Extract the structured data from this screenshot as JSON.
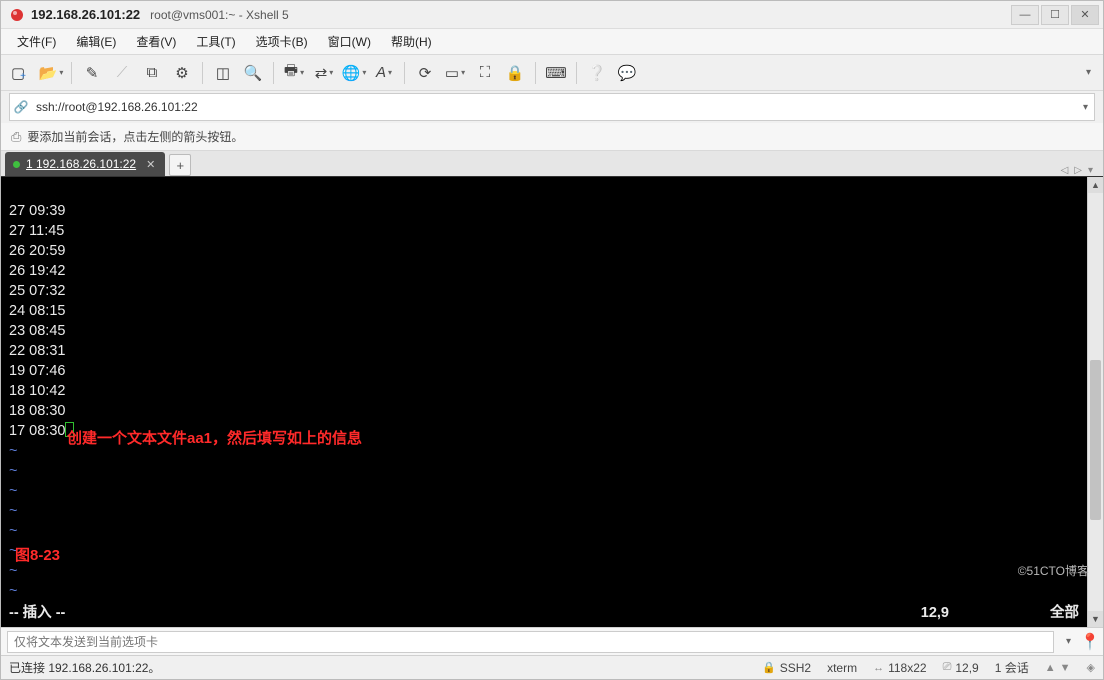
{
  "title": {
    "main": "192.168.26.101:22",
    "sub": "root@vms001:~ - Xshell 5"
  },
  "menu": {
    "file": "文件(F)",
    "edit": "编辑(E)",
    "view": "查看(V)",
    "tools": "工具(T)",
    "tab": "选项卡(B)",
    "window": "窗口(W)",
    "help": "帮助(H)"
  },
  "address": {
    "url": "ssh://root@192.168.26.101:22"
  },
  "hint": {
    "text": "要添加当前会话，点击左侧的箭头按钮。"
  },
  "tab": {
    "label": "1 192.168.26.101:22"
  },
  "terminal": {
    "lines": [
      "27 09:39",
      "27 11:45",
      "26 20:59",
      "26 19:42",
      "25 07:32",
      "24 08:15",
      "23 08:45",
      "22 08:31",
      "19 07:46",
      "18 10:42",
      "18 08:30",
      "17 08:30"
    ],
    "overlay_msg": "创建一个文本文件aa1，然后填写如上的信息",
    "overlay_fig": "图8-23",
    "status_mode": "-- 插入 --",
    "status_pos": "12,9",
    "status_scope": "全部"
  },
  "sendbar": {
    "placeholder": "仅将文本发送到当前选项卡"
  },
  "status": {
    "conn": "已连接 192.168.26.101:22。",
    "proto": "SSH2",
    "term": "xterm",
    "size": "118x22",
    "pos": "12,9",
    "sessions": "1 会话"
  },
  "watermark": "©51CTO博客"
}
